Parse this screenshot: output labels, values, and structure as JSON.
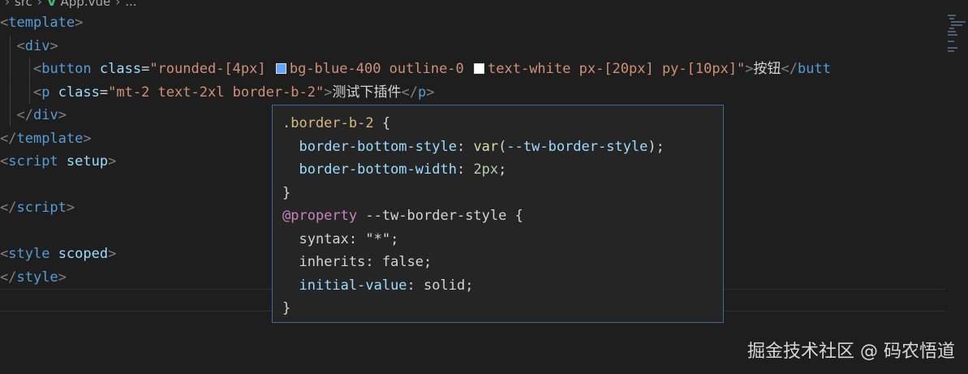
{
  "breadcrumb": {
    "folder": "src",
    "file": "App.vue",
    "more": "..."
  },
  "code": {
    "l1_tag": "template",
    "l2_tag": "div",
    "l3_tag": "button",
    "l3_attr": "class",
    "l3_val_a": "\"rounded-[4px] ",
    "l3_val_b": "bg-blue-400 outline-0 ",
    "l3_val_c": "text-white px-[20px] py-[10px]\"",
    "l3_text": "按钮",
    "l3_close_tag": "butt",
    "l4_tag": "p",
    "l4_attr": "class",
    "l4_val": "\"mt-2 text-2xl border-b-2\"",
    "l4_text": "测试下插件",
    "l4_close_tag": "p",
    "l5_tag": "div",
    "l6_tag": "template",
    "l7_tag": "script",
    "l7_attr": "setup",
    "l9_tag": "script",
    "l11_tag": "style",
    "l11_attr": "scoped",
    "l12_tag": "style"
  },
  "swatches": {
    "blue": "#60a5fa",
    "white": "#ffffff"
  },
  "hover": {
    "selector": ".border-b-2",
    "p1": "border-bottom-style",
    "v1_fn": "var",
    "v1_arg": "--tw-border-style",
    "p2": "border-bottom-width",
    "v2": "2px",
    "at": "@property",
    "at_name": "--tw-border-style",
    "p3": "syntax",
    "v3": "\"*\"",
    "p4": "inherits",
    "v4": "false",
    "p5": "initial-value",
    "v5": "solid"
  },
  "watermark": "掘金技术社区 @ 码农悟道"
}
